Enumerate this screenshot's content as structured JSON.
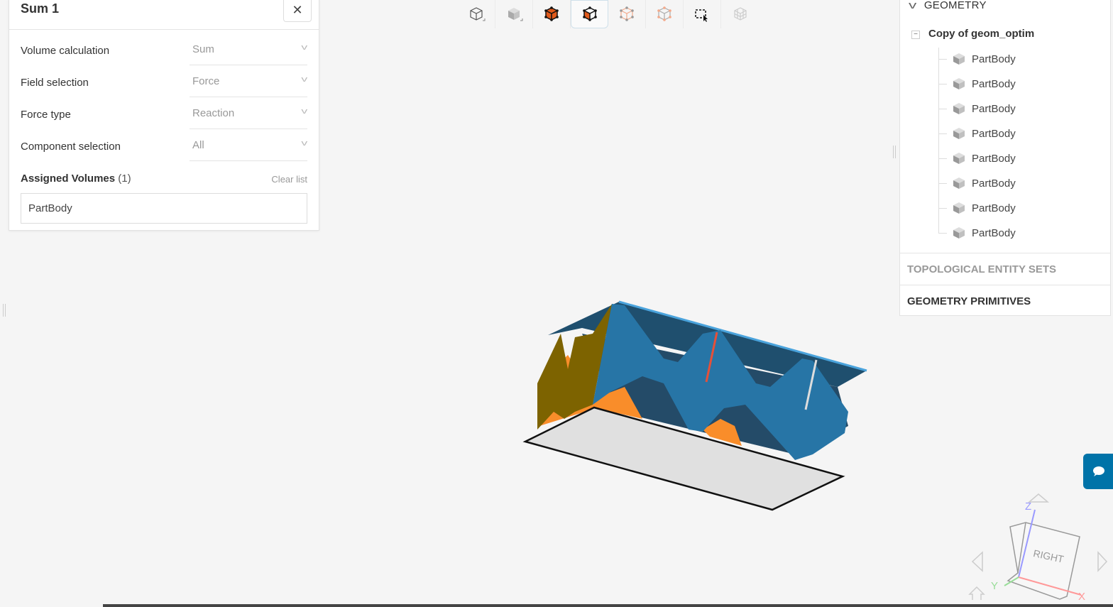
{
  "panel": {
    "title": "Sum 1",
    "close_icon": "close-icon",
    "fields": [
      {
        "label": "Volume calculation",
        "value": "Sum"
      },
      {
        "label": "Field selection",
        "value": "Force"
      },
      {
        "label": "Force type",
        "value": "Reaction"
      },
      {
        "label": "Component selection",
        "value": "All"
      }
    ],
    "assigned_label": "Assigned Volumes",
    "assigned_count": "(1)",
    "clear_label": "Clear list",
    "assigned_items": [
      "PartBody"
    ]
  },
  "toolbar": {
    "icons": [
      "iso-view-icon",
      "solid-view-icon",
      "surface-select-icon",
      "volume-select-icon",
      "edge-select-icon",
      "point-select-icon",
      "box-select-icon",
      "mesh-view-icon"
    ]
  },
  "tree": {
    "section": "GEOMETRY",
    "root": "Copy of geom_optim",
    "items": [
      "PartBody",
      "PartBody",
      "PartBody",
      "PartBody",
      "PartBody",
      "PartBody",
      "PartBody",
      "PartBody"
    ],
    "sections": [
      "TOPOLOGICAL ENTITY SETS",
      "GEOMETRY PRIMITIVES"
    ]
  },
  "viewcube": {
    "face": "RIGHT",
    "axes": {
      "x": "X",
      "y": "Y",
      "z": "Z"
    }
  },
  "colors": {
    "accent": "#0073a8",
    "blue": "#2775a6",
    "dark_blue": "#1f4f6e",
    "orange": "#f98d2a",
    "olive": "#7d6300",
    "plate": "#e0e0e0"
  }
}
